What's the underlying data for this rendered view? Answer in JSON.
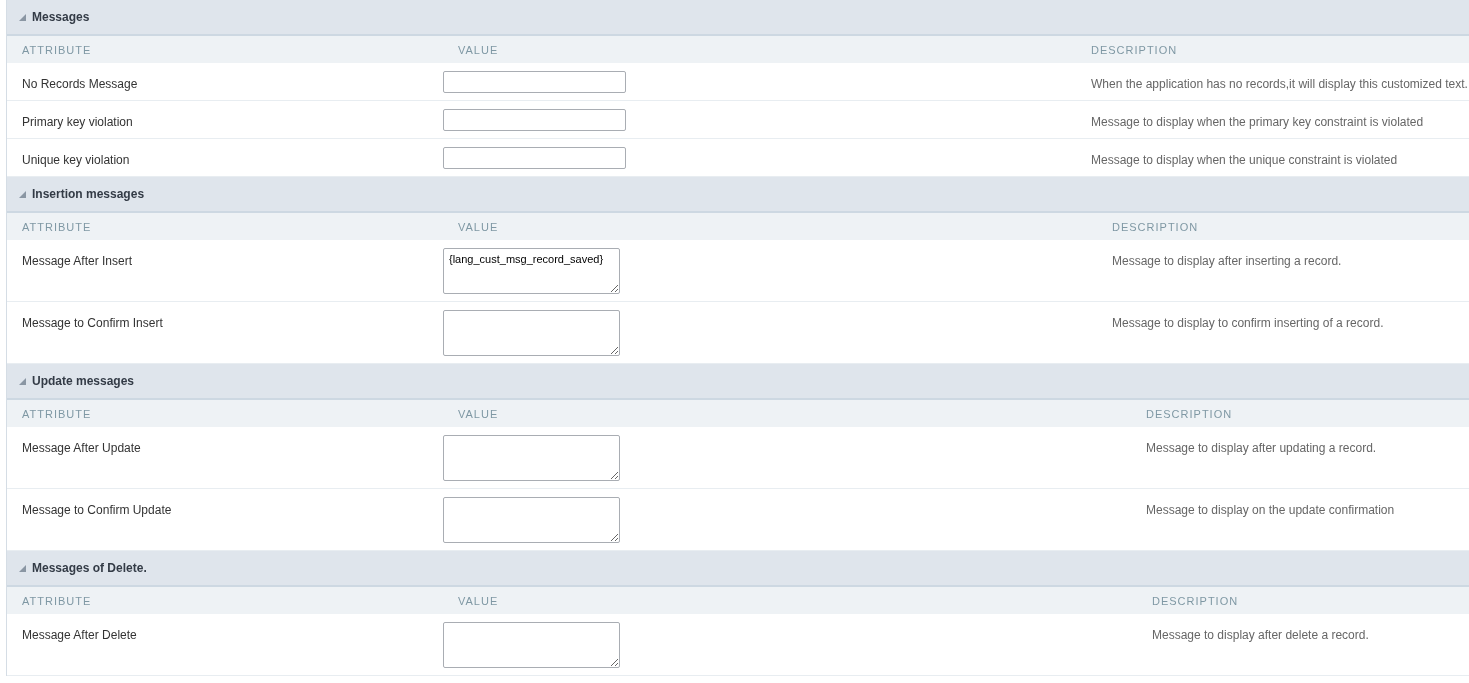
{
  "sections": [
    {
      "title": "Messages",
      "expanded": true,
      "columns": [
        "ATTRIBUTE",
        "VALUE",
        "DESCRIPTION"
      ],
      "rows": [
        {
          "attribute": "No Records Message",
          "kind": "input",
          "description": "When the application has no records,it will display this customized text."
        },
        {
          "attribute": "Primary key violation",
          "kind": "input",
          "description": "Message to display when the primary key constraint is violated"
        },
        {
          "attribute": "Unique key violation",
          "kind": "input",
          "description": "Message to display when the unique constraint is violated"
        }
      ]
    },
    {
      "title": "Insertion messages",
      "expanded": true,
      "columns": [
        "ATTRIBUTE",
        "VALUE",
        "DESCRIPTION"
      ],
      "rows": [
        {
          "attribute": "Message After Insert",
          "kind": "textarea",
          "value": "{lang_cust_msg_record_saved}",
          "description": "Message to display after inserting a record."
        },
        {
          "attribute": "Message to Confirm Insert",
          "kind": "textarea",
          "description": "Message to display to confirm inserting of a record."
        }
      ]
    },
    {
      "title": "Update messages",
      "expanded": true,
      "columns": [
        "ATTRIBUTE",
        "VALUE",
        "DESCRIPTION"
      ],
      "rows": [
        {
          "attribute": "Message After Update",
          "kind": "textarea",
          "description": "Message to display after updating a record."
        },
        {
          "attribute": "Message to Confirm Update",
          "kind": "textarea",
          "description": "Message to display on the update confirmation"
        }
      ]
    },
    {
      "title": "Messages of Delete.",
      "expanded": true,
      "columns": [
        "ATTRIBUTE",
        "VALUE",
        "DESCRIPTION"
      ],
      "rows": [
        {
          "attribute": "Message After Delete",
          "kind": "textarea",
          "description": "Message to display after delete a record."
        }
      ]
    }
  ]
}
